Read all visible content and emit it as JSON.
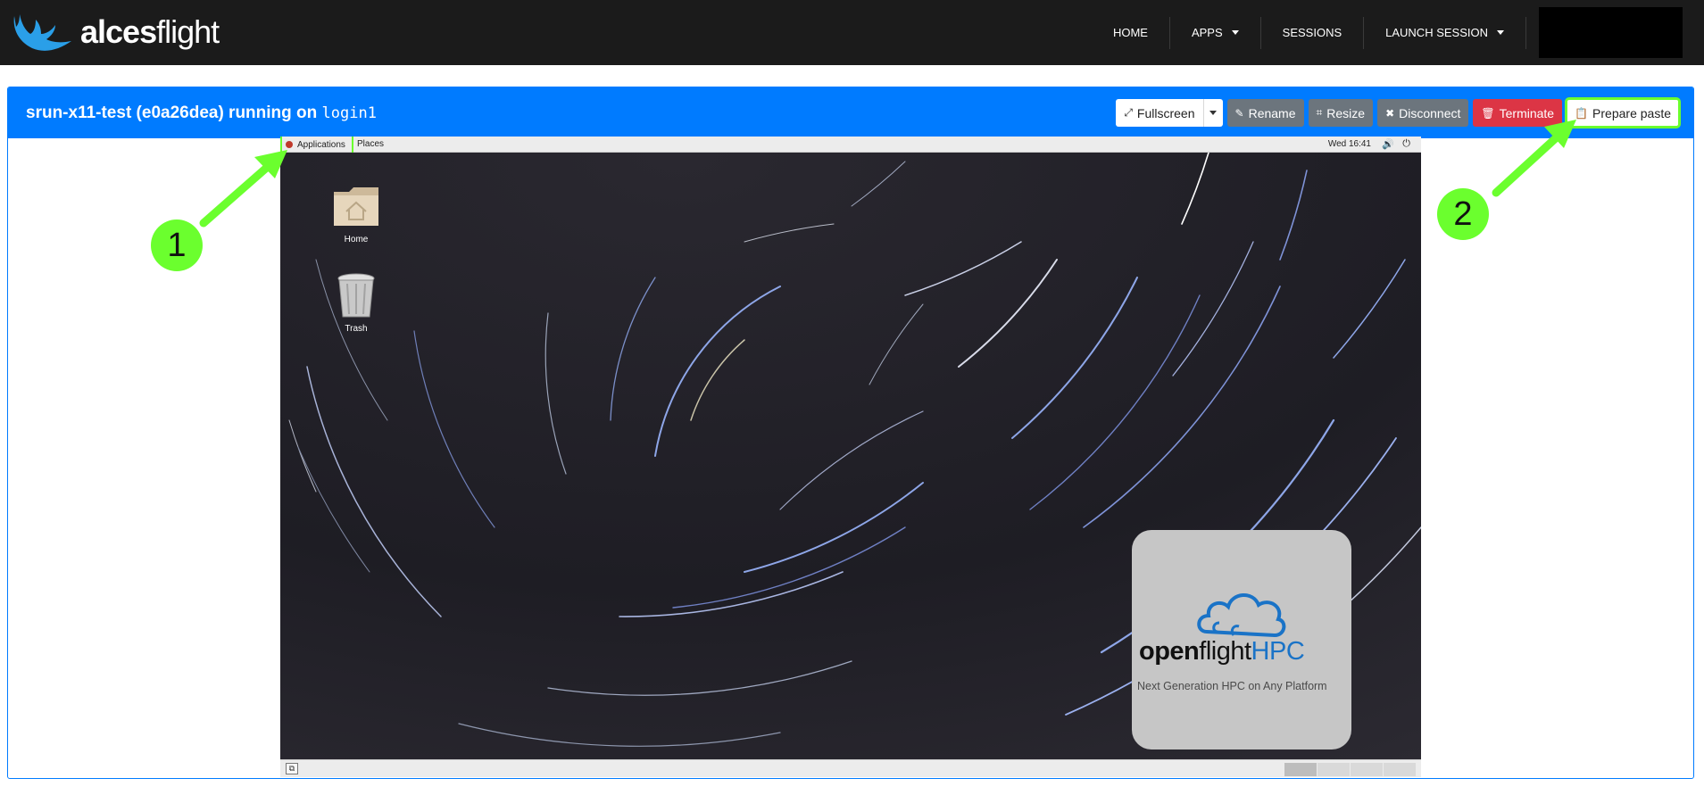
{
  "brand": {
    "bold": "alces",
    "light": "flight"
  },
  "nav": {
    "home": "HOME",
    "apps": "APPS",
    "sessions": "SESSIONS",
    "launch_session": "LAUNCH SESSION"
  },
  "session": {
    "title_prefix": "srun-x11-test (e0a26dea) running on",
    "host": "login1"
  },
  "toolbar": {
    "fullscreen": "Fullscreen",
    "rename": "Rename",
    "resize": "Resize",
    "disconnect": "Disconnect",
    "terminate": "Terminate",
    "prepare_paste": "Prepare paste"
  },
  "desktop": {
    "topbar": {
      "applications": "Applications",
      "places": "Places",
      "clock": "Wed 16:41"
    },
    "icons": {
      "home": "Home",
      "trash": "Trash"
    },
    "logo": {
      "open": "open",
      "flight": "flight",
      "hpc": "HPC",
      "tagline": "Next Generation HPC on Any Platform"
    }
  },
  "annotations": {
    "one": "1",
    "two": "2"
  },
  "colors": {
    "navbar": "#1b1b1b",
    "primary": "#007bff",
    "secondary": "#6c757d",
    "danger": "#dc3545",
    "highlight": "#6bff2e",
    "brand_blue": "#1a73c7"
  }
}
